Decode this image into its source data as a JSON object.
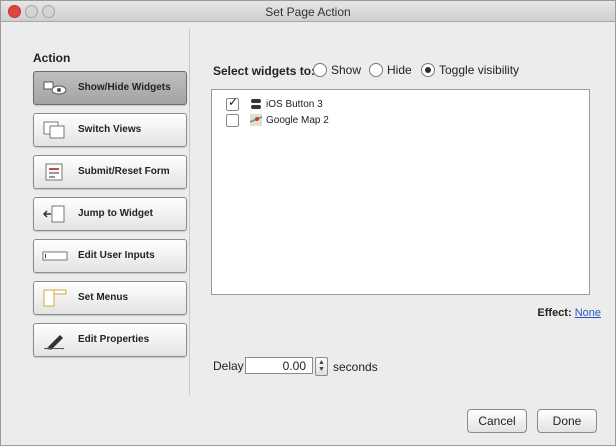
{
  "window": {
    "title": "Set Page Action"
  },
  "sidebar": {
    "heading": "Action",
    "items": [
      {
        "label": "Show/Hide Widgets",
        "icon": "show-hide-icon",
        "active": true
      },
      {
        "label": "Switch Views",
        "icon": "switch-views-icon",
        "active": false
      },
      {
        "label": "Submit/Reset Form",
        "icon": "form-icon",
        "active": false
      },
      {
        "label": "Jump to Widget",
        "icon": "jump-icon",
        "active": false
      },
      {
        "label": "Edit User Inputs",
        "icon": "input-field-icon",
        "active": false
      },
      {
        "label": "Set Menus",
        "icon": "menu-icon",
        "active": false
      },
      {
        "label": "Edit Properties",
        "icon": "pencil-icon",
        "active": false
      }
    ]
  },
  "main": {
    "select_label": "Select widgets to:",
    "options": [
      {
        "label": "Show",
        "selected": false
      },
      {
        "label": "Hide",
        "selected": false
      },
      {
        "label": "Toggle visibility",
        "selected": true
      }
    ],
    "widgets": [
      {
        "label": "iOS Button 3",
        "checked": true,
        "icon": "ios-button-icon"
      },
      {
        "label": "Google Map 2",
        "checked": false,
        "icon": "google-map-icon"
      }
    ],
    "effect_label": "Effect:",
    "effect_value": "None",
    "delay_label": "Delay",
    "delay_value": "0.00",
    "delay_unit": "seconds"
  },
  "footer": {
    "cancel_label": "Cancel",
    "done_label": "Done"
  }
}
